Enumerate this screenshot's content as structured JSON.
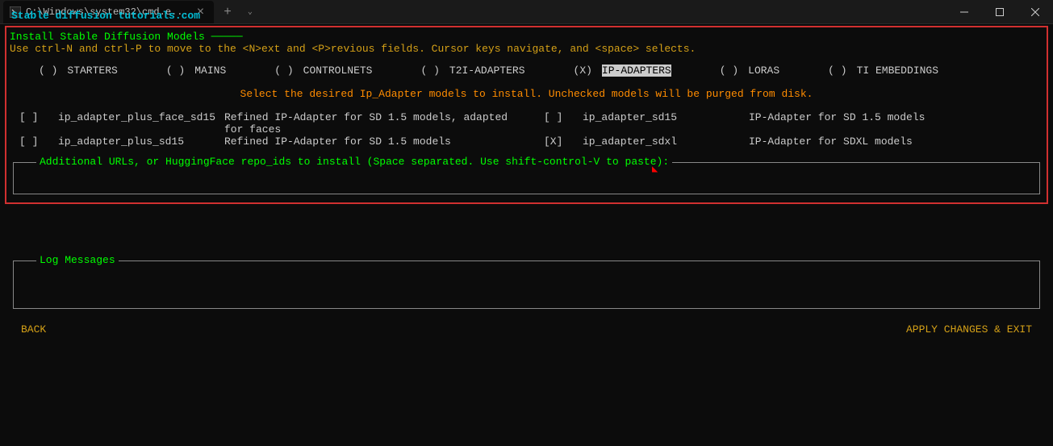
{
  "window": {
    "tab_title": "C:\\Windows\\system32\\cmd.e..."
  },
  "watermark": "Stable diffusion tutorials.com",
  "installer": {
    "title": "Install Stable Diffusion Models",
    "help": "Use ctrl-N and ctrl-P to move to the <N>ext and <P>revious fields. Cursor keys navigate, and <space> selects.",
    "tabs": [
      {
        "mark": "( )",
        "label": "STARTERS",
        "selected": false
      },
      {
        "mark": "( )",
        "label": "MAINS",
        "selected": false
      },
      {
        "mark": "( )",
        "label": "CONTROLNETS",
        "selected": false
      },
      {
        "mark": "( )",
        "label": "T2I-ADAPTERS",
        "selected": false
      },
      {
        "mark": "(X)",
        "label": "IP-ADAPTERS",
        "selected": true
      },
      {
        "mark": "( )",
        "label": "LORAS",
        "selected": false
      },
      {
        "mark": "( )",
        "label": "TI EMBEDDINGS",
        "selected": false
      }
    ],
    "instruction": "Select the desired Ip_Adapter models to install. Unchecked models will be purged from disk.",
    "models_left": [
      {
        "chk": "[ ]",
        "name": "ip_adapter_plus_face_sd15",
        "desc": "Refined IP-Adapter for SD 1.5 models, adapted for faces"
      },
      {
        "chk": "[ ]",
        "name": "ip_adapter_plus_sd15",
        "desc": "Refined IP-Adapter for SD 1.5 models"
      }
    ],
    "models_right": [
      {
        "chk": "[ ]",
        "name": "ip_adapter_sd15",
        "desc": "IP-Adapter for SD 1.5 models"
      },
      {
        "chk": "[X]",
        "name": "ip_adapter_sdxl",
        "desc": "IP-Adapter for SDXL models"
      }
    ],
    "additional_label": "Additional URLs, or HuggingFace repo_ids to install (Space separated. Use shift-control-V to paste):"
  },
  "log": {
    "title": "Log Messages"
  },
  "footer": {
    "back": "BACK",
    "apply": "APPLY CHANGES & EXIT"
  }
}
